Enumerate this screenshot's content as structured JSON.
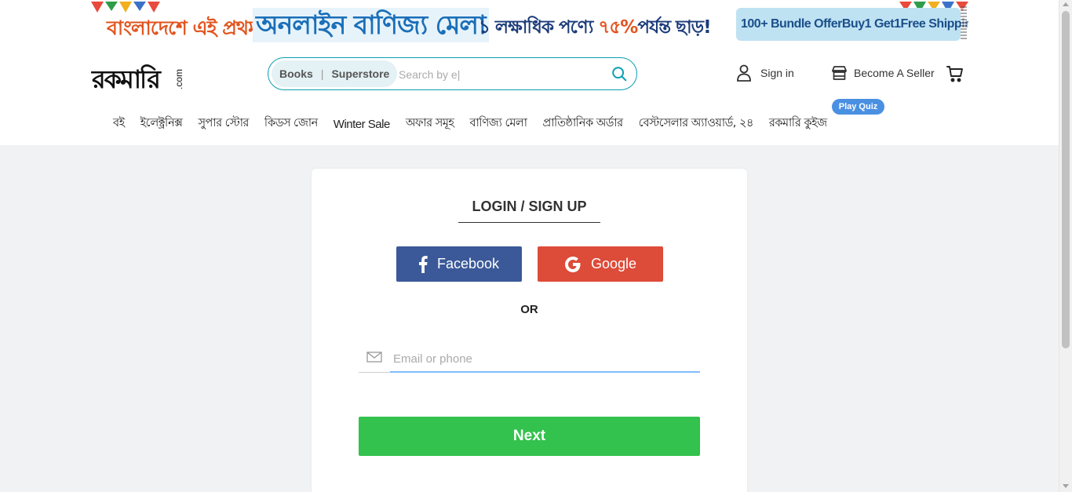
{
  "banner": {
    "text_left": "বাংলাদেশে এই প্রথম",
    "text_mid": "অনলাইন বাণিজ্য মেলা",
    "text_right": "১ লক্ষাধিক পণ্যে",
    "text_pct": "৭৫%",
    "text_tail": "পর্যন্ত ছাড়!",
    "offers": [
      "100+ Bundle Offer",
      "Buy1 Get1",
      "Free Shipping"
    ]
  },
  "logo": {
    "text": "রকমারি",
    "suffix": ".com"
  },
  "search": {
    "cat_books": "Books",
    "cat_sep": "|",
    "cat_superstore": "Superstore",
    "placeholder": "Search by e|"
  },
  "header": {
    "signin_label": "Sign in",
    "seller_label": "Become A Seller"
  },
  "nav": {
    "items": [
      "বই",
      "ইলেক্ট্রনিক্স",
      "সুপার স্টোর",
      "কিডস জোন",
      "Winter Sale",
      "অফার সমূহ",
      "বাণিজ্য মেলা",
      "প্রাতিষ্ঠানিক অর্ডার",
      "বেস্টসেলার অ্যাওয়ার্ড, ২৪",
      "রকমারি কুইজ"
    ],
    "quiz_badge": "Play Quiz"
  },
  "login": {
    "title": "LOGIN / SIGN UP",
    "facebook_label": "Facebook",
    "google_label": "Google",
    "or_label": "OR",
    "email_placeholder": "Email or phone",
    "next_label": "Next"
  },
  "colors": {
    "facebook": "#3b5998",
    "google": "#dd4b39",
    "next": "#33c24d",
    "search_border": "#0b9fb2",
    "quiz_badge": "#4a90e2"
  },
  "icons": [
    "user-icon",
    "store-icon",
    "cart-icon",
    "search-icon",
    "facebook-icon",
    "google-icon",
    "mail-icon"
  ]
}
